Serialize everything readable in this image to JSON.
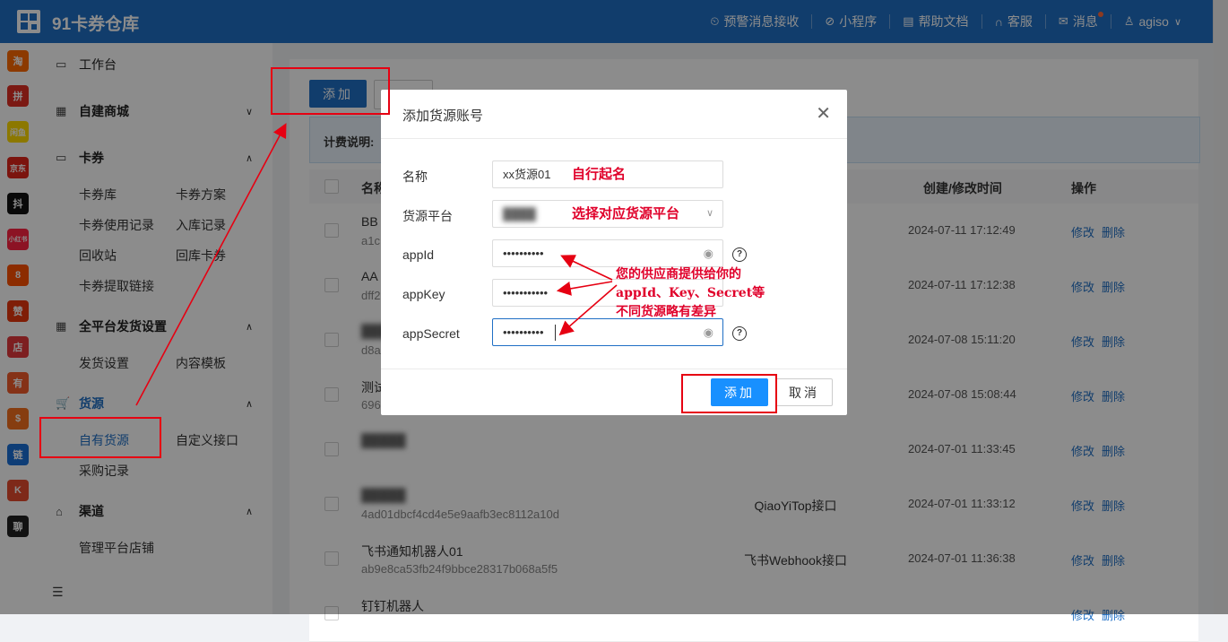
{
  "header": {
    "brand": "91卡券仓库",
    "nav": [
      {
        "icon": "alert-icon",
        "label": "预警消息接收"
      },
      {
        "icon": "miniapp-icon",
        "label": "小程序"
      },
      {
        "icon": "doc-icon",
        "label": "帮助文档"
      },
      {
        "icon": "headset-icon",
        "label": "客服"
      },
      {
        "icon": "mail-icon",
        "label": "消息"
      },
      {
        "icon": "user-icon",
        "label": "agiso"
      }
    ]
  },
  "app_strip": [
    {
      "name": "taobao",
      "label": "淘",
      "color": "#ff6a00"
    },
    {
      "name": "pinduoduo",
      "label": "拼",
      "color": "#e02e24"
    },
    {
      "name": "app3",
      "label": "闲鱼",
      "color": "#ffda00"
    },
    {
      "name": "jd",
      "label": "京东",
      "color": "#e1251b"
    },
    {
      "name": "douyin",
      "label": "抖",
      "color": "#111111"
    },
    {
      "name": "xiaohongshu",
      "label": "小红书",
      "color": "#ff2442"
    },
    {
      "name": "app7",
      "label": "8",
      "color": "#ff5000"
    },
    {
      "name": "app8",
      "label": "赞",
      "color": "#e8380d"
    },
    {
      "name": "dian",
      "label": "店",
      "color": "#e4393c"
    },
    {
      "name": "app10",
      "label": "有",
      "color": "#f25b2b"
    },
    {
      "name": "app11",
      "label": "$",
      "color": "#f5701e"
    },
    {
      "name": "app12",
      "label": "链",
      "color": "#1a6fd8"
    },
    {
      "name": "app13",
      "label": "K",
      "color": "#e64b2e"
    },
    {
      "name": "app14",
      "label": "聊",
      "color": "#222222"
    }
  ],
  "sidebar": {
    "workbench": "工作台",
    "groups": [
      {
        "label": "自建商城",
        "expanded": false
      },
      {
        "label": "卡券",
        "expanded": true
      },
      {
        "label": "全平台发货设置",
        "expanded": true
      },
      {
        "label": "货源",
        "expanded": true
      },
      {
        "label": "渠道",
        "expanded": true
      }
    ],
    "card_items": [
      "卡券库",
      "卡券方案",
      "卡券使用记录",
      "入库记录",
      "回收站",
      "回库卡券",
      "卡券提取链接"
    ],
    "ship_items": [
      "发货设置",
      "内容模板"
    ],
    "source_items": [
      "自有货源",
      "自定义接口",
      "采购记录"
    ],
    "channel_items": [
      "管理平台店铺"
    ]
  },
  "main": {
    "add_button": "添加",
    "info_label": "计费说明:",
    "columns": [
      "名称",
      "创建/修改时间",
      "操作"
    ],
    "rows": [
      {
        "name": "BB",
        "id": "a1c",
        "type": "",
        "time": "2024-07-11 17:12:49"
      },
      {
        "name": "AA",
        "id": "dff2",
        "type": "",
        "time": "2024-07-11 17:12:38"
      },
      {
        "name": "",
        "id": "d8a",
        "type": "",
        "time": "2024-07-08 15:11:20"
      },
      {
        "name": "测试",
        "id": "696",
        "type": "",
        "time": "2024-07-08 15:08:44"
      },
      {
        "name": "",
        "id": "",
        "type": "",
        "time": "2024-07-01 11:33:45"
      },
      {
        "name": "",
        "id": "4ad01dbcf4cd4e5e9aafb3ec8112a10d",
        "type": "QiaoYiTop接口",
        "time": "2024-07-01 11:33:12"
      },
      {
        "name": "飞书通知机器人01",
        "id": "ab9e8ca53fb24f9bbce28317b068a5f5",
        "type": "飞书Webhook接口",
        "time": "2024-07-01 11:36:38"
      },
      {
        "name": "钉钉机器人",
        "id": "",
        "type": "",
        "time": ""
      }
    ],
    "actions": {
      "edit": "修改",
      "delete": "删除"
    }
  },
  "modal": {
    "title": "添加货源账号",
    "fields": [
      {
        "label": "名称",
        "value": "xx货源01",
        "note": "自行起名"
      },
      {
        "label": "货源平台",
        "value": "",
        "note": "选择对应货源平台"
      },
      {
        "label": "appId",
        "value": "••••••••••"
      },
      {
        "label": "appKey",
        "value": "•••••••••••"
      },
      {
        "label": "appSecret",
        "value": "••••••••••"
      }
    ],
    "submit": "添加",
    "cancel": "取消",
    "annotation": [
      "您的供应商提供给你的",
      "appId、Key、Secret等",
      "不同货源略有差异"
    ]
  },
  "colors": {
    "primary": "#1f6fc5",
    "annotation": "#e0002a"
  }
}
